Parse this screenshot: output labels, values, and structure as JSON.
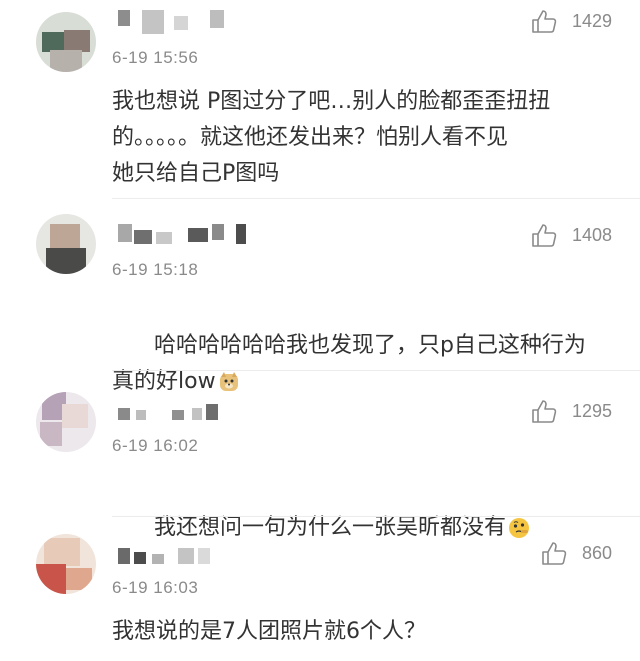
{
  "comments": [
    {
      "timestamp": "6-19 15:56",
      "likes": "1429",
      "text": "我也想说 P图过分了吧…别人的脸都歪歪扭扭\n的。。。。。就这他还发出来？怕别人看不见\n她只给自己P图吗",
      "emoji": ""
    },
    {
      "timestamp": "6-19 15:18",
      "likes": "1408",
      "text": "哈哈哈哈哈哈我也发现了，只p自己这种行为\n真的好low",
      "emoji": "doge-emoji"
    },
    {
      "timestamp": "6-19 16:02",
      "likes": "1295",
      "text": "我还想问一句为什么一张吴昕都没有",
      "emoji": "thinking-emoji"
    },
    {
      "timestamp": "6-19 16:03",
      "likes": "860",
      "text": "我想说的是7人团照片就6个人？",
      "emoji": ""
    }
  ],
  "colors": {
    "text": "#333333",
    "meta": "#8a8a8a",
    "divider": "#ececec"
  },
  "icons": {
    "like": "thumbs-up-icon"
  }
}
